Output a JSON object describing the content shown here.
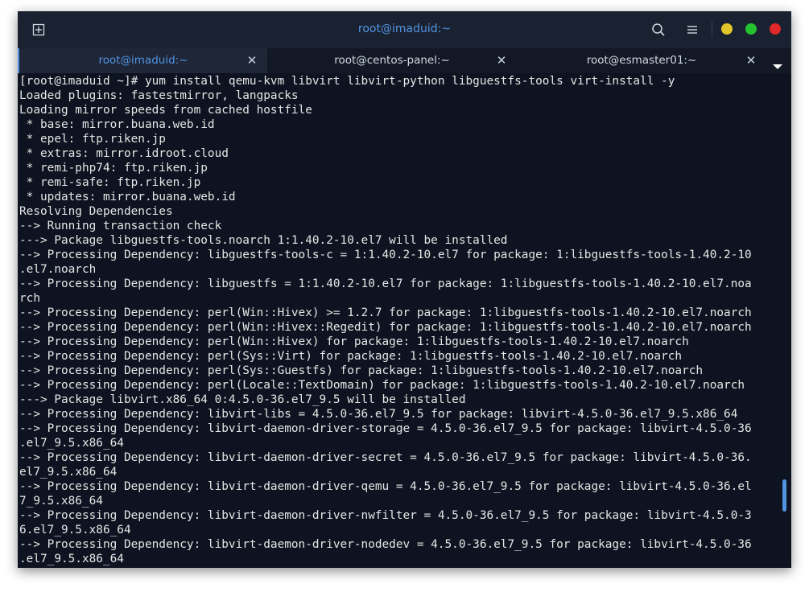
{
  "window": {
    "title": "root@imaduid:~"
  },
  "tabs": [
    {
      "label": "root@imaduid:~",
      "active": true
    },
    {
      "label": "root@centos-panel:~",
      "active": false
    },
    {
      "label": "root@esmaster01:~",
      "active": false
    }
  ],
  "icons": {
    "new_tab": "new-tab-icon",
    "search": "search-icon",
    "menu": "hamburger-menu-icon",
    "tab_close": "close-icon",
    "tab_dropdown": "chevron-down-icon"
  },
  "colors": {
    "accent": "#5294e2",
    "background": "#0d1320",
    "minimize": "#e0c62a",
    "maximize": "#25c330",
    "close": "#e02828"
  },
  "terminal": {
    "lines": [
      "[root@imaduid ~]# yum install qemu-kvm libvirt libvirt-python libguestfs-tools virt-install -y",
      "Loaded plugins: fastestmirror, langpacks",
      "Loading mirror speeds from cached hostfile",
      " * base: mirror.buana.web.id",
      " * epel: ftp.riken.jp",
      " * extras: mirror.idroot.cloud",
      " * remi-php74: ftp.riken.jp",
      " * remi-safe: ftp.riken.jp",
      " * updates: mirror.buana.web.id",
      "Resolving Dependencies",
      "--> Running transaction check",
      "---> Package libguestfs-tools.noarch 1:1.40.2-10.el7 will be installed",
      "--> Processing Dependency: libguestfs-tools-c = 1:1.40.2-10.el7 for package: 1:libguestfs-tools-1.40.2-10",
      ".el7.noarch",
      "--> Processing Dependency: libguestfs = 1:1.40.2-10.el7 for package: 1:libguestfs-tools-1.40.2-10.el7.noa",
      "rch",
      "--> Processing Dependency: perl(Win::Hivex) >= 1.2.7 for package: 1:libguestfs-tools-1.40.2-10.el7.noarch",
      "--> Processing Dependency: perl(Win::Hivex::Regedit) for package: 1:libguestfs-tools-1.40.2-10.el7.noarch",
      "--> Processing Dependency: perl(Win::Hivex) for package: 1:libguestfs-tools-1.40.2-10.el7.noarch",
      "--> Processing Dependency: perl(Sys::Virt) for package: 1:libguestfs-tools-1.40.2-10.el7.noarch",
      "--> Processing Dependency: perl(Sys::Guestfs) for package: 1:libguestfs-tools-1.40.2-10.el7.noarch",
      "--> Processing Dependency: perl(Locale::TextDomain) for package: 1:libguestfs-tools-1.40.2-10.el7.noarch",
      "---> Package libvirt.x86_64 0:4.5.0-36.el7_9.5 will be installed",
      "--> Processing Dependency: libvirt-libs = 4.5.0-36.el7_9.5 for package: libvirt-4.5.0-36.el7_9.5.x86_64",
      "--> Processing Dependency: libvirt-daemon-driver-storage = 4.5.0-36.el7_9.5 for package: libvirt-4.5.0-36",
      ".el7_9.5.x86_64",
      "--> Processing Dependency: libvirt-daemon-driver-secret = 4.5.0-36.el7_9.5 for package: libvirt-4.5.0-36.",
      "el7_9.5.x86_64",
      "--> Processing Dependency: libvirt-daemon-driver-qemu = 4.5.0-36.el7_9.5 for package: libvirt-4.5.0-36.el",
      "7_9.5.x86_64",
      "--> Processing Dependency: libvirt-daemon-driver-nwfilter = 4.5.0-36.el7_9.5 for package: libvirt-4.5.0-3",
      "6.el7_9.5.x86_64",
      "--> Processing Dependency: libvirt-daemon-driver-nodedev = 4.5.0-36.el7_9.5 for package: libvirt-4.5.0-36",
      ".el7_9.5.x86_64"
    ]
  }
}
